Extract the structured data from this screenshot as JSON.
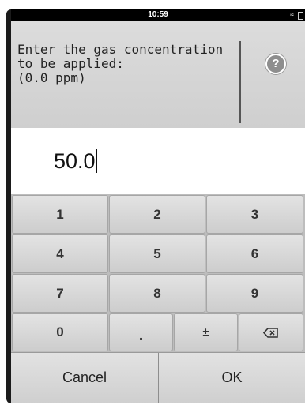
{
  "status_bar": {
    "time": "10:59",
    "wifi_icon": "wifi-icon",
    "battery_icon": "battery-icon"
  },
  "prompt": {
    "lines": [
      "Enter the gas concentration",
      "to be applied:",
      "(0.0 ppm)"
    ],
    "help_icon": "help-icon",
    "help_label": "?"
  },
  "entry": {
    "value": "50.0"
  },
  "keypad": {
    "rows": [
      [
        "1",
        "2",
        "3"
      ],
      [
        "4",
        "5",
        "6"
      ],
      [
        "7",
        "8",
        "9"
      ]
    ],
    "last_row": {
      "zero": "0",
      "decimal": ".",
      "sign": "±",
      "backspace_icon": "backspace-icon"
    }
  },
  "actions": {
    "cancel": "Cancel",
    "ok": "OK"
  },
  "colors": {
    "screen_bg": "#d6d6d6",
    "key_face": "#d8d8d8",
    "frame": "#1b1b1b"
  }
}
